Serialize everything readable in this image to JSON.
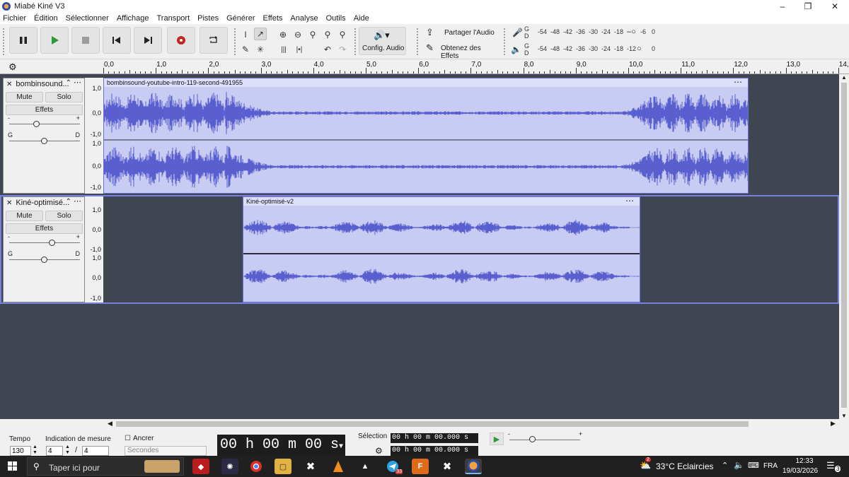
{
  "window": {
    "title": "Miabé Kiné V3"
  },
  "menu": [
    "Fichier",
    "Édition",
    "Sélectionner",
    "Affichage",
    "Transport",
    "Pistes",
    "Générer",
    "Effets",
    "Analyse",
    "Outils",
    "Aide"
  ],
  "toolbar": {
    "config_audio_label": "Config. Audio",
    "share_audio_label": "Partager l'Audio",
    "get_effects_label": "Obtenez des Effets",
    "meter_ticks": [
      "-54",
      "-48",
      "-42",
      "-36",
      "-30",
      "-24",
      "-18",
      "-6",
      "0"
    ],
    "meter_ticks_play": [
      "-54",
      "-48",
      "-42",
      "-36",
      "-30",
      "-24",
      "-18",
      "-12",
      "0"
    ],
    "meter_rec_channels": [
      "G",
      "D"
    ],
    "meter_play_channels": [
      "G",
      "D"
    ]
  },
  "ruler": {
    "labels": [
      "0,0",
      "1,0",
      "2,0",
      "3,0",
      "4,0",
      "5,0",
      "6,0",
      "7,0",
      "8,0",
      "9,0",
      "10,0",
      "11,0",
      "12,0",
      "13,0",
      "14,0"
    ]
  },
  "tracks": [
    {
      "name": "bombinsound...",
      "clip_name": "bombinsound-youtube-intro-119-second-491955",
      "mute": "Mute",
      "solo": "Solo",
      "effects": "Effets",
      "gain_minus": "-",
      "gain_plus": "+",
      "pan_left": "G",
      "pan_right": "D",
      "scale": [
        "1,0",
        "0,0",
        "-1,0",
        "1,0",
        "0,0",
        "-1,0"
      ]
    },
    {
      "name": "Kiné-optimisé...",
      "clip_name": "Kiné-optimisé-v2",
      "mute": "Mute",
      "solo": "Solo",
      "effects": "Effets",
      "gain_minus": "-",
      "gain_plus": "+",
      "pan_left": "G",
      "pan_right": "D",
      "scale": [
        "1,0",
        "0,0",
        "-1,0",
        "1,0",
        "0,0",
        "-1,0"
      ]
    }
  ],
  "bottom": {
    "tempo_label": "Tempo",
    "tempo_value": "130",
    "time_sig_label": "Indication de mesure",
    "time_sig_num": "4",
    "time_sig_den": "4",
    "snap_label": "Ancrer",
    "snap_unit": "Secondes",
    "time_display": "00 h 00 m 00 s",
    "selection_label": "Sélection",
    "sel_start": "00 h 00 m 00.000 s",
    "sel_end": "00 h 00 m 00.000 s",
    "speed_minus": "-",
    "speed_plus": "+"
  },
  "taskbar": {
    "search_placeholder": "Taper ici pour",
    "weather": "33°C  Eclaircies",
    "weather_badge": "2",
    "lang": "FRA",
    "time": "12:33",
    "date": "19/03/2026",
    "notif_count": "3",
    "app_badge": "33"
  },
  "colors": {
    "waveform": "#5a5fd0",
    "clip_bg": "#c8ccf2",
    "track_bg": "#404552",
    "selected_track_border": "#7880e0"
  }
}
